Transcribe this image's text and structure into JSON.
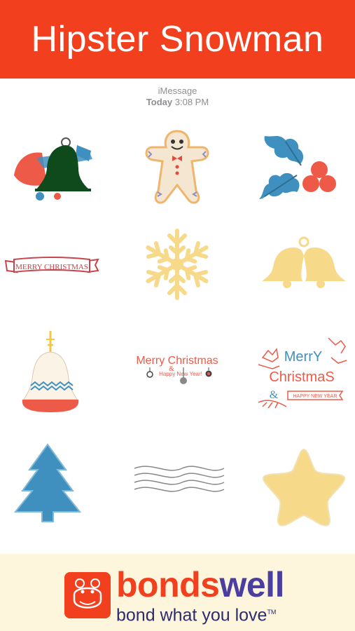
{
  "header": {
    "title": "Hipster Snowman"
  },
  "thread": {
    "service": "iMessage",
    "day": "Today",
    "time": "3:08 PM"
  },
  "stickers": [
    {
      "name": "bells-sticker"
    },
    {
      "name": "gingerbread-sticker"
    },
    {
      "name": "holly-sticker"
    },
    {
      "name": "merry-christmas-ribbon-sticker",
      "text": "MERRY CHRISTMAS"
    },
    {
      "name": "snowflake-sticker"
    },
    {
      "name": "yellow-bells-sticker"
    },
    {
      "name": "bell-ornament-sticker"
    },
    {
      "name": "merry-christmas-happy-new-year-sticker",
      "line1": "Merry Christmas",
      "amp": "&",
      "line2": "Happy New Year!"
    },
    {
      "name": "merry-christmas-deer-sticker",
      "line1": "MerrY",
      "line2": "ChristmaS",
      "amp": "&",
      "ribbon": "HAPPY NEW YEAR"
    },
    {
      "name": "tree-sticker"
    },
    {
      "name": "wavy-lines-sticker"
    },
    {
      "name": "star-sticker"
    }
  ],
  "footer": {
    "brand_part1": "bonds",
    "brand_part2": "well",
    "tagline": "bond what you love",
    "trademark": "TM",
    "colors": {
      "brand_red": "#f2401f",
      "brand_purple": "#4a3ea0",
      "background": "#fdf6dc"
    }
  },
  "colors": {
    "header_bg": "#f2401f",
    "sticker_red": "#ee5a48",
    "sticker_blue": "#3f8fbf",
    "sticker_yellow": "#f7d98a"
  }
}
